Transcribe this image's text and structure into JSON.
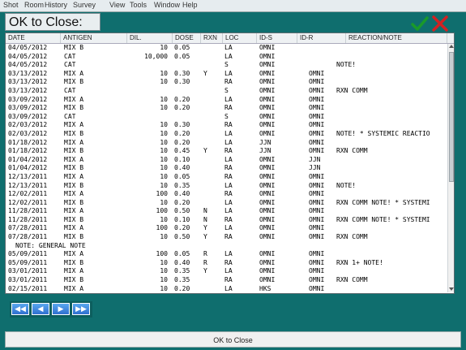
{
  "menu": [
    "Shot",
    "Room",
    "History"
  ],
  "ghost_menu": [
    "Survey",
    "View",
    "Tools",
    "Window",
    "Help"
  ],
  "header": {
    "title": "OK to Close:"
  },
  "columns": [
    "DATE",
    "ANTIGEN",
    "DIL.",
    "DOSE",
    "RXN",
    "LOC",
    "ID-S",
    "ID-R",
    "REACTION/NOTE"
  ],
  "rows": [
    [
      "04/05/2012",
      "MIX B",
      "10",
      "0.05",
      "",
      "LA",
      "OMNI",
      "",
      ""
    ],
    [
      "04/05/2012",
      "CAT",
      "10,000",
      "0.05",
      "",
      "LA",
      "OMNI",
      "",
      ""
    ],
    [
      "04/05/2012",
      "CAT",
      "",
      "",
      "",
      "S",
      "OMNI",
      "",
      "NOTE!"
    ],
    [
      "03/13/2012",
      "MIX A",
      "10",
      "0.30",
      "Y",
      "LA",
      "OMNI",
      "OMNI",
      ""
    ],
    [
      "03/13/2012",
      "MIX B",
      "10",
      "0.30",
      "",
      "RA",
      "OMNI",
      "OMNI",
      ""
    ],
    [
      "03/13/2012",
      "CAT",
      "",
      "",
      "",
      "S",
      "OMNI",
      "OMNI",
      "RXN COMM"
    ],
    [
      "03/09/2012",
      "MIX A",
      "10",
      "0.20",
      "",
      "LA",
      "OMNI",
      "OMNI",
      ""
    ],
    [
      "03/09/2012",
      "MIX B",
      "10",
      "0.20",
      "",
      "RA",
      "OMNI",
      "OMNI",
      ""
    ],
    [
      "03/09/2012",
      "CAT",
      "",
      "",
      "",
      "S",
      "OMNI",
      "OMNI",
      ""
    ],
    [
      "02/03/2012",
      "MIX A",
      "10",
      "0.30",
      "",
      "RA",
      "OMNI",
      "OMNI",
      ""
    ],
    [
      "02/03/2012",
      "MIX B",
      "10",
      "0.20",
      "",
      "LA",
      "OMNI",
      "OMNI",
      "NOTE! * SYSTEMIC REACTIO"
    ],
    [
      "01/18/2012",
      "MIX A",
      "10",
      "0.20",
      "",
      "LA",
      "JJN",
      "OMNI",
      ""
    ],
    [
      "01/18/2012",
      "MIX B",
      "10",
      "0.45",
      "Y",
      "RA",
      "JJN",
      "OMNI",
      "RXN COMM"
    ],
    [
      "01/04/2012",
      "MIX A",
      "10",
      "0.10",
      "",
      "LA",
      "OMNI",
      "JJN",
      ""
    ],
    [
      "01/04/2012",
      "MIX B",
      "10",
      "0.40",
      "",
      "RA",
      "OMNI",
      "JJN",
      ""
    ],
    [
      "12/13/2011",
      "MIX A",
      "10",
      "0.05",
      "",
      "RA",
      "OMNI",
      "OMNI",
      ""
    ],
    [
      "12/13/2011",
      "MIX B",
      "10",
      "0.35",
      "",
      "LA",
      "OMNI",
      "OMNI",
      "NOTE!"
    ],
    [
      "12/02/2011",
      "MIX A",
      "100",
      "0.40",
      "",
      "RA",
      "OMNI",
      "OMNI",
      ""
    ],
    [
      "12/02/2011",
      "MIX B",
      "10",
      "0.20",
      "",
      "LA",
      "OMNI",
      "OMNI",
      "RXN COMM NOTE! * SYSTEMI"
    ],
    [
      "11/28/2011",
      "MIX A",
      "100",
      "0.50",
      "N",
      "LA",
      "OMNI",
      "OMNI",
      ""
    ],
    [
      "11/28/2011",
      "MIX B",
      "10",
      "0.10",
      "N",
      "RA",
      "OMNI",
      "OMNI",
      "RXN COMM NOTE! * SYSTEMI"
    ],
    [
      "07/28/2011",
      "MIX A",
      "100",
      "0.20",
      "Y",
      "LA",
      "OMNI",
      "OMNI",
      ""
    ],
    [
      "07/28/2011",
      "MIX B",
      "10",
      "0.50",
      "Y",
      "RA",
      "OMNI",
      "OMNI",
      "RXN COMM"
    ],
    [
      "NOTE: GENERAL NOTE"
    ],
    [
      "05/09/2011",
      "MIX A",
      "100",
      "0.05",
      "R",
      "LA",
      "OMNI",
      "OMNI",
      ""
    ],
    [
      "05/09/2011",
      "MIX B",
      "10",
      "0.40",
      "R",
      "RA",
      "OMNI",
      "OMNI",
      "RXN 1+ NOTE!"
    ],
    [
      "03/01/2011",
      "MIX A",
      "10",
      "0.35",
      "Y",
      "LA",
      "OMNI",
      "OMNI",
      ""
    ],
    [
      "03/01/2011",
      "MIX B",
      "10",
      "0.35",
      "",
      "RA",
      "OMNI",
      "OMNI",
      "RXN COMM"
    ],
    [
      "02/15/2011",
      "MIX A",
      "10",
      "0.20",
      "",
      "LA",
      "HKS",
      "OMNI",
      ""
    ],
    [
      "02/15/2011",
      "MIX B",
      "10",
      "0.20",
      "",
      "RA",
      "HKS",
      "OMNI",
      ""
    ],
    [
      "02/01/2011",
      "MIX A",
      "10",
      "0.10",
      "",
      "LA",
      "HKS",
      "HKS",
      ""
    ]
  ],
  "nav": {
    "first": "first-icon",
    "prev": "prev-icon",
    "next": "next-icon",
    "last": "last-icon"
  },
  "footer": {
    "ok_label": "OK to Close"
  },
  "colors": {
    "background": "#0f6e6e",
    "check": "#1a9a2a",
    "cancel": "#d22222",
    "nav_button": "#3b82e0"
  }
}
